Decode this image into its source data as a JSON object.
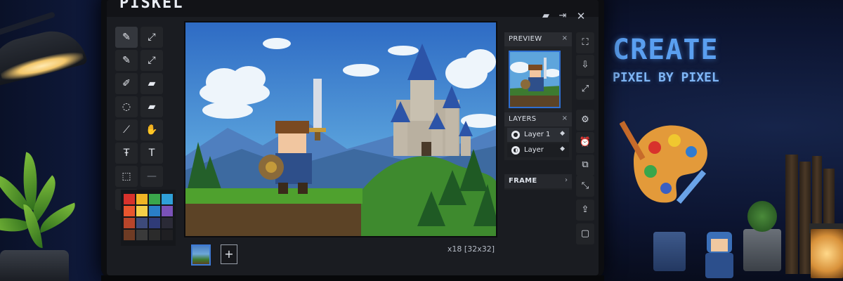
{
  "app": {
    "name": "PISKEL"
  },
  "window_icons": [
    "folder-icon",
    "export-icon",
    "close-icon"
  ],
  "tools": [
    {
      "name": "pen-tool",
      "glyph": "✎",
      "active": true
    },
    {
      "name": "vertical-mirror-pen-tool",
      "glyph": "⤢"
    },
    {
      "name": "stroke-tool",
      "glyph": "✎"
    },
    {
      "name": "paint-bucket-tool",
      "glyph": "⤢"
    },
    {
      "name": "pencil-tool",
      "glyph": "✐"
    },
    {
      "name": "eraser-tool",
      "glyph": "▰"
    },
    {
      "name": "lasso-tool",
      "glyph": "◌"
    },
    {
      "name": "eraser-alt-tool",
      "glyph": "▰"
    },
    {
      "name": "line-tool",
      "glyph": "⟋"
    },
    {
      "name": "move-hand-tool",
      "glyph": "✋"
    },
    {
      "name": "dither-tool",
      "glyph": "Ŧ"
    },
    {
      "name": "text-tool",
      "glyph": "T"
    },
    {
      "name": "rect-select-tool",
      "glyph": "⬚"
    },
    {
      "name": "shape-select-tool",
      "glyph": "—"
    },
    {
      "name": "more-tool",
      "glyph": "··"
    }
  ],
  "palette": {
    "colors": [
      "#d8322c",
      "#f0b525",
      "#3aa64b",
      "#2fa0d8",
      "#e9562e",
      "#f4d04a",
      "#2a7fc8",
      "#7a52b8",
      "#b8452a",
      "#3d4a7a",
      "#2f3b78",
      "#2a2a36",
      "#6e3b24",
      "#3a3a3a",
      "#2b2b2b",
      "#1f1f22"
    ]
  },
  "preview": {
    "title": "PREVIEW",
    "close": "×"
  },
  "layers": {
    "title": "LAYERS",
    "close": "×",
    "items": [
      {
        "label": "Layer 1",
        "icon": "●",
        "marker": "◆"
      },
      {
        "label": "Layer",
        "icon": "◐",
        "marker": "◆"
      }
    ]
  },
  "frame_panel": {
    "title": "FRAME",
    "chevron": "›"
  },
  "frames": {
    "add_label": "+"
  },
  "status": {
    "zoom": "x18 [32x32]"
  },
  "side_buttons": [
    "crop-icon",
    "import-icon",
    "resize-icon",
    "settings-icon",
    "alarm-icon",
    "copy-icon",
    "scale-icon",
    "export-gif-icon",
    "clipboard-icon"
  ],
  "poster": {
    "line1": "CREATE",
    "line2": "PIXEL BY PIXEL"
  }
}
